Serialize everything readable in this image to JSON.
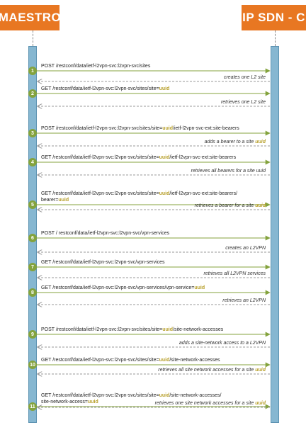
{
  "actors": {
    "left": "MAESTRO",
    "right": "IP SDN - C"
  },
  "colors": {
    "actor": "#e87722",
    "request_arrow": "#84a33d",
    "uuid_highlight": "#b8a02c",
    "lifeline": "#86b7d1"
  },
  "steps": [
    {
      "n": "1",
      "request": [
        "POST /restconf/data/ietf-l2vpn-svc:l2vpn-svc/sites"
      ],
      "response": "creates one L2 site"
    },
    {
      "n": "2",
      "request": [
        "GET /restconf/data/ietf-l2vpn-svc:l2vpn-svc/sites/site=",
        "uuid"
      ],
      "response": "retrieves one L2 site"
    },
    {
      "n": "3",
      "request": [
        "POST /restconf/data/ietf-l2vpn-svc:l2vpn-svc/sites/site=",
        "uuid",
        "/ietf-l2vpn-svc-ext:site-bearers"
      ],
      "response": [
        "adds a bearer to a site ",
        "uuid"
      ]
    },
    {
      "n": "4",
      "request": [
        "GET /restconf/data/ietf-l2vpn-svc:l2vpn-svc/sites/site=",
        "uuid",
        "/ietf-l2vpn-svc-ext:site-bearers"
      ],
      "response": "retrieves all bearers for a site uuid"
    },
    {
      "n": "5",
      "request": [
        "GET /restconf/data/ietf-l2vpn-svc:l2vpn-svc/sites/site=",
        "uuid",
        "/ietf-l2vpn-svc-ext:site-bearers/",
        "bearer=",
        "uuid"
      ],
      "response": [
        "retrieves a bearer for a site ",
        "uuid"
      ]
    },
    {
      "n": "6",
      "request": [
        "POST / restconf/data/ietf-l2vpn-svc:l2vpn-svc/vpn-services"
      ],
      "response": "creates an L2VPN"
    },
    {
      "n": "7",
      "request": [
        "GET /restconf/data/ietf-l2vpn-svc:l2vpn-svc/vpn-services"
      ],
      "response": "retrieves all L2VPN services"
    },
    {
      "n": "8",
      "request": [
        "GET /restconf/data/ietf-l2vpn-svc:l2vpn-svc/vpn-services/vpn-service=",
        "uuid"
      ],
      "response": "retrieves an L2VPN"
    },
    {
      "n": "9",
      "request": [
        "POST /restconf/data/ietf-l2vpn-svc:l2vpn-svc/sites/site=",
        "uuid",
        "/site-network-accesses"
      ],
      "response": "adds a site-network access to a L2VPN"
    },
    {
      "n": "10",
      "request": [
        "GET /restconf/data/ietf-l2vpn-svc:l2vpn-svc/sites/site=",
        "uuid",
        "/site-network-accesses"
      ],
      "response": [
        "retrieves all site network accesses for a site ",
        "uuid"
      ]
    },
    {
      "n": "11",
      "request": [
        "GET /restconf/data/ietf-l2vpn-svc:l2vpn-svc/sites/site=",
        "uuid",
        "/site-network-accesses/",
        "site-network-access=",
        "uuid"
      ],
      "response": [
        "retrieves one site network accesses for a site ",
        "uuid"
      ]
    }
  ]
}
